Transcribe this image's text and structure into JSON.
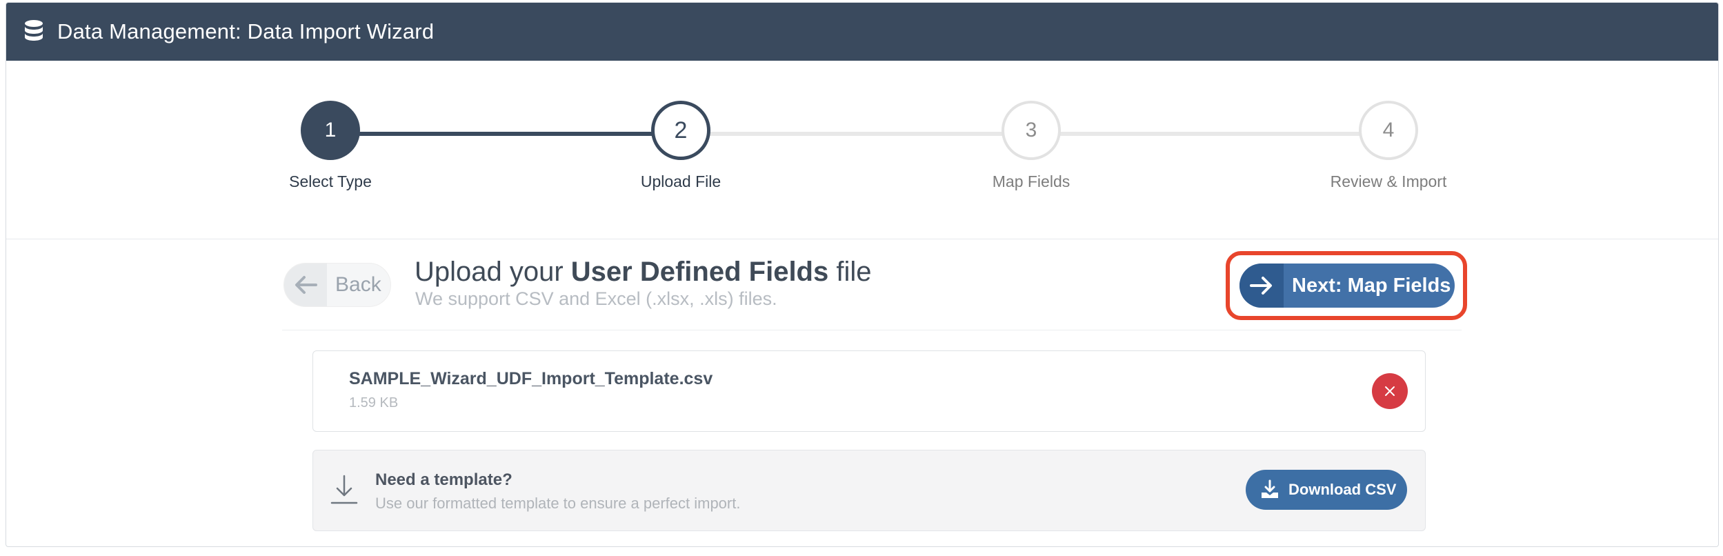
{
  "window": {
    "title": "Data Management: Data Import Wizard"
  },
  "steps": [
    {
      "number": "1",
      "label": "Select Type",
      "state": "complete"
    },
    {
      "number": "2",
      "label": "Upload File",
      "state": "active"
    },
    {
      "number": "3",
      "label": "Map Fields",
      "state": "pending"
    },
    {
      "number": "4",
      "label": "Review & Import",
      "state": "pending"
    }
  ],
  "header": {
    "back_label": "Back",
    "title_prefix": "Upload your ",
    "title_bold": "User Defined Fields",
    "title_suffix": " file",
    "subtitle": "We support CSV and Excel (.xlsx, .xls) files.",
    "next_label": "Next: Map Fields"
  },
  "file": {
    "name": "SAMPLE_Wizard_UDF_Import_Template.csv",
    "size": "1.59 KB"
  },
  "template": {
    "title": "Need a template?",
    "subtitle": "Use our formatted template to ensure a perfect import.",
    "download_label": "Download CSV"
  },
  "colors": {
    "titlebar": "#3a4a5e",
    "primary": "#4271a8",
    "highlight": "#e8452c",
    "danger": "#d63b43"
  }
}
